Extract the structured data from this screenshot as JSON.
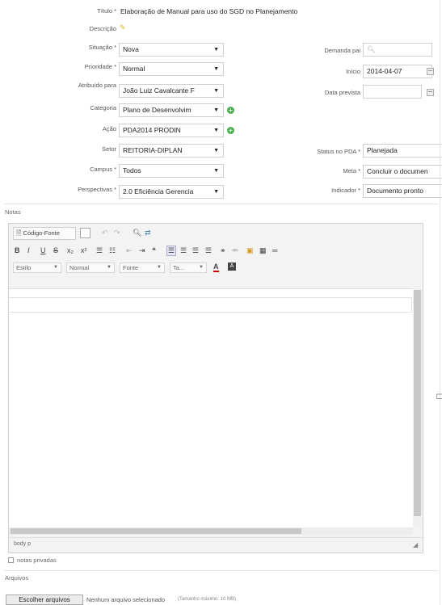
{
  "form": {
    "titulo_label": "Título *",
    "titulo_value": "Elaboração de Manual para uso do SGD no Planejamento",
    "descricao_label": "Descrição",
    "situacao_label": "Situação *",
    "situacao_value": "Nova",
    "prioridade_label": "Prioridade *",
    "prioridade_value": "Normal",
    "atribuido_label": "Atribuído para",
    "atribuido_value": "João Luiz Cavalcante F",
    "categoria_label": "Categoria",
    "categoria_value": "Plano de Desenvolvim",
    "acao_label": "Ação",
    "acao_value": "PDA2014 PRODIN",
    "setor_label": "Setor",
    "setor_value": "REITORIA-DIPLAN",
    "campus_label": "Campus *",
    "campus_value": "Todos",
    "perspectivas_label": "Perspectivas *",
    "perspectivas_value": "2.0 Eficiência Gerencia",
    "demanda_pai_label": "Demanda pai",
    "inicio_label": "Início",
    "inicio_value": "2014-04-07",
    "data_prevista_label": "Data prevista",
    "status_pda_label": "Status no PDA *",
    "status_pda_value": "Planejada",
    "meta_label": "Meta *",
    "meta_value": "Concluir o documen",
    "indicador_label": "Indicador *",
    "indicador_value": "Documento pronto"
  },
  "notes": {
    "label": "Notas",
    "source_button": "Código-Fonte",
    "style_select": "Estilo",
    "format_select": "Normal",
    "font_select": "Fonte",
    "size_select": "Ta...",
    "status_path": "body  p",
    "private_notes_label": "notas privadas"
  },
  "attachments": {
    "label": "Arquivos",
    "choose_button": "Escolher arquivos",
    "no_file": "Nenhum arquivo selecionado",
    "max_size": "(Tamanho máximo: 10 MB)"
  }
}
